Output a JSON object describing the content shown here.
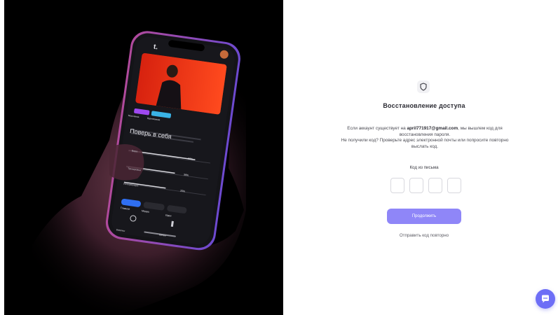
{
  "hero": {
    "phone_app": {
      "logo": "t.",
      "tag_1": "Мышление",
      "tag_2": "Вдохновение",
      "card_title": "Поверь в себя",
      "card_subtitle": "Уверенность в своих силах — ключ к развитию и успеху в любом деле",
      "rows": [
        {
          "label": "Вера",
          "value": "80%"
        },
        {
          "label": "Тренировка",
          "value": "38%"
        },
        {
          "label": "Интервенция",
          "value": "25%"
        }
      ],
      "bottom_buttons": [
        "Главное",
        "Медиа",
        "Идеи"
      ],
      "nav_items": [
        "Вопросы",
        "Кнопки"
      ]
    }
  },
  "recovery": {
    "icon": "shield-icon",
    "title": "Восстановление доступа",
    "desc_prefix": "Если аккаунт существует на",
    "email": "april771917@gmail.com",
    "desc_suffix": ", мы вышлем код для восстановления пароля.",
    "desc_line2": "Не получили код? Проверьте адрес электронной почты или попросите повторно выслать код.",
    "code_label": "Код из письма",
    "code_digits": [
      "",
      "",
      "",
      ""
    ],
    "continue_label": "Продолжить",
    "resend_label": "Отправить код повторно"
  },
  "chat": {
    "icon": "chat-bubble-icon"
  },
  "colors": {
    "accent": "#8f86f8",
    "chat": "#6d6ef6",
    "hero_bg": "#000000"
  }
}
